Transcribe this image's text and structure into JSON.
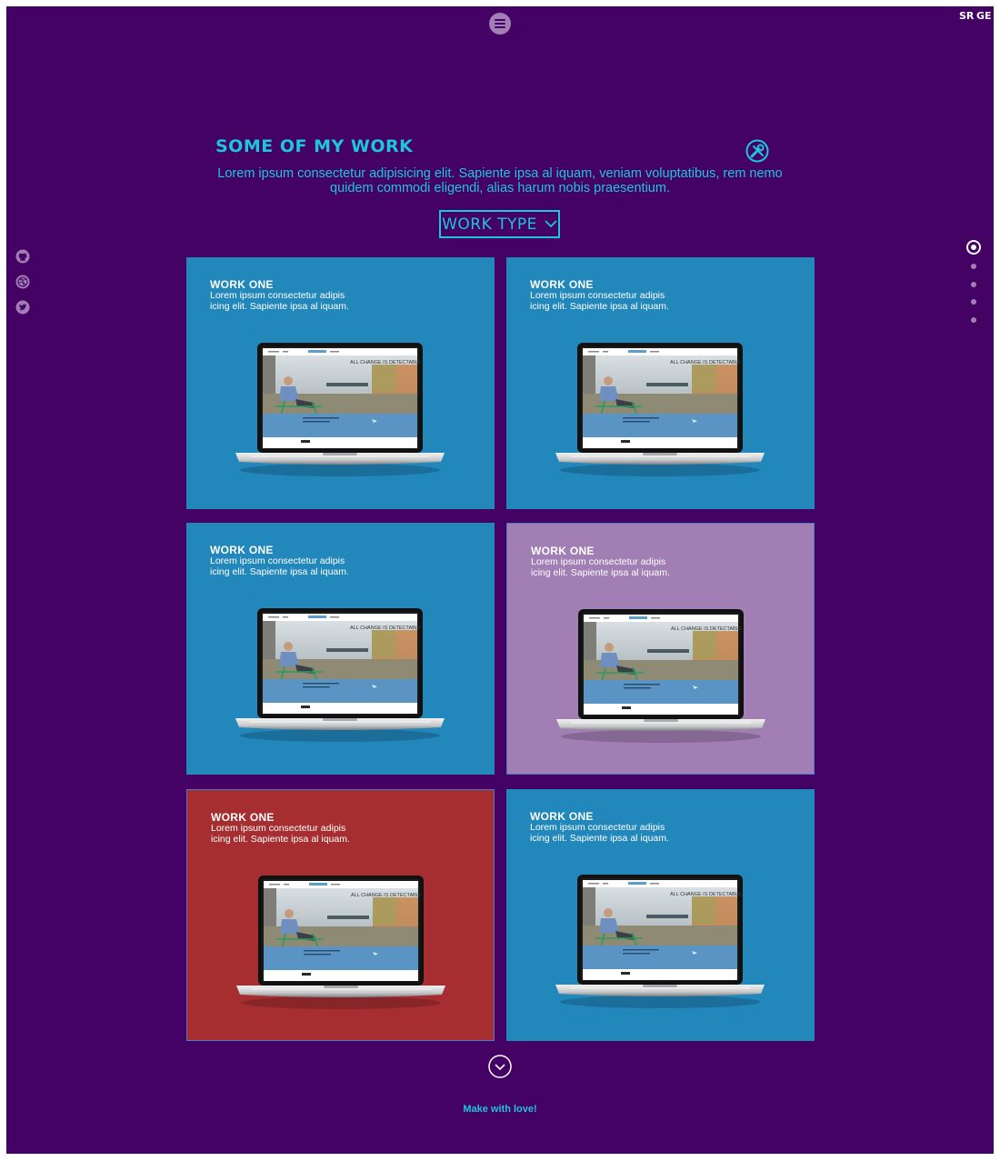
{
  "header": {
    "menu_icon": "hamburger-icon",
    "languages": [
      "SR",
      "GE"
    ]
  },
  "section": {
    "title": "SOME OF MY WORK",
    "icon": "tools-icon",
    "intro": "Lorem ipsum consectetur adipisicing elit. Sapiente ipsa al iquam, veniam voluptatibus, rem nemo quidem commodi eligendi, alias harum nobis praesentium.",
    "filter_label": "WORK TYPE",
    "filter_icon": "chevron-down-icon"
  },
  "social": [
    "github-icon",
    "dribbble-icon",
    "twitter-icon"
  ],
  "page_dots": {
    "count": 5,
    "active": 0
  },
  "works": [
    {
      "title": "WORK ONE",
      "desc": "Lorem ipsum consectetur adipis icing elit. Sapiente ipsa al iquam.",
      "color": "#2287bb"
    },
    {
      "title": "WORK ONE",
      "desc": "Lorem ipsum consectetur adipis icing elit. Sapiente ipsa al iquam.",
      "color": "#2287bb"
    },
    {
      "title": "WORK ONE",
      "desc": "Lorem ipsum consectetur adipis icing elit. Sapiente ipsa al iquam.",
      "color": "#2287bb"
    },
    {
      "title": "WORK ONE",
      "desc": "Lorem ipsum consectetur adipis icing elit. Sapiente ipsa al iquam.",
      "color": "#a17fb4"
    },
    {
      "title": "WORK ONE",
      "desc": "Lorem ipsum consectetur adipis icing elit. Sapiente ipsa al iquam.",
      "color": "#a62e31"
    },
    {
      "title": "WORK ONE",
      "desc": "Lorem ipsum consectetur adipis icing elit. Sapiente ipsa al iquam.",
      "color": "#2287bb"
    }
  ],
  "laptop_screen_text": "ALL CHANGE IS DETECTABLE",
  "scroll_icon": "chevron-circle-down-icon",
  "footer": {
    "note": "Make with love!"
  },
  "colors": {
    "background": "#440364",
    "accent": "#1cc6dc"
  }
}
